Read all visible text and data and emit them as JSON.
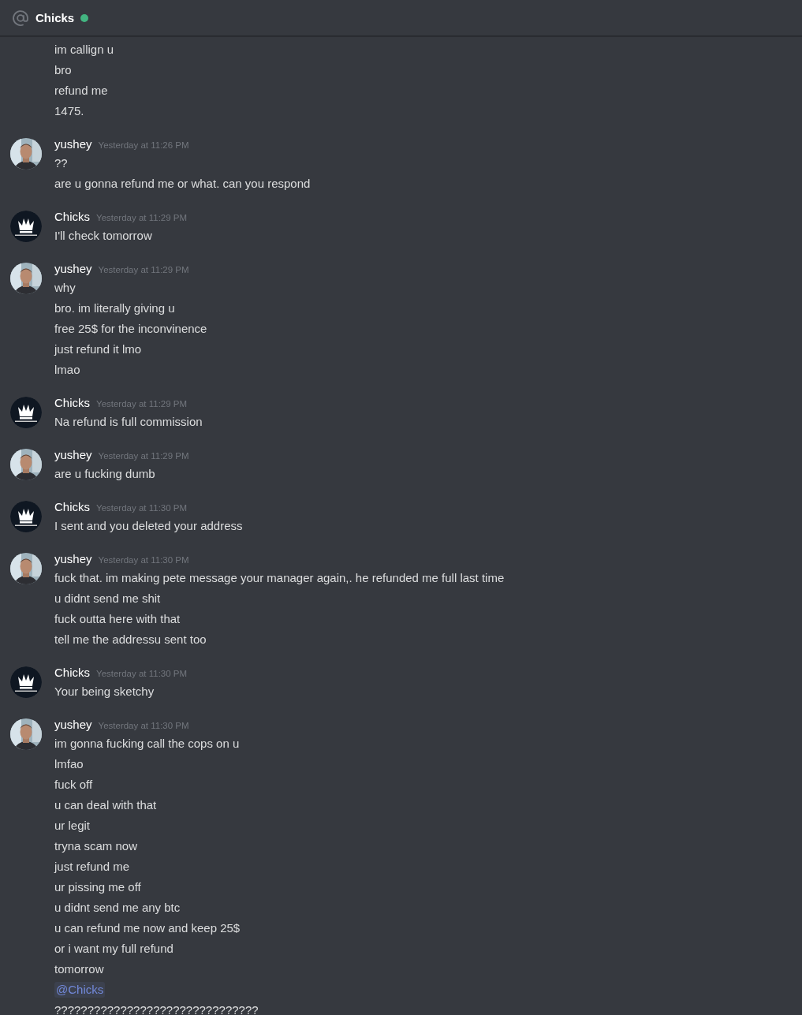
{
  "header": {
    "title": "Chicks",
    "online": true
  },
  "messages": [
    {
      "lines": [
        {
          "kind": "text",
          "text": "im callign u"
        },
        {
          "kind": "text",
          "text": "bro"
        },
        {
          "kind": "text",
          "text": "refund me"
        },
        {
          "kind": "text",
          "text": "1475."
        }
      ]
    },
    {
      "author": "yushey",
      "avatar": {
        "kind": "picture"
      },
      "timestamp": "Yesterday at 11:26 PM",
      "lines": [
        {
          "kind": "text",
          "text": "??"
        },
        {
          "kind": "text",
          "text": "are u gonna refund me or what. can you respond"
        }
      ]
    },
    {
      "author": "Chicks",
      "avatar": {
        "kind": "logo"
      },
      "timestamp": "Yesterday at 11:29 PM",
      "lines": [
        {
          "kind": "text",
          "text": "I'll check tomorrow"
        }
      ]
    },
    {
      "author": "yushey",
      "avatar": {
        "kind": "picture"
      },
      "timestamp": "Yesterday at 11:29 PM",
      "lines": [
        {
          "kind": "text",
          "text": "why"
        },
        {
          "kind": "text",
          "text": "bro. im literally giving u"
        },
        {
          "kind": "text",
          "text": "free 25$ for the inconvinence"
        },
        {
          "kind": "text",
          "text": "just refund it lmo"
        },
        {
          "kind": "text",
          "text": "lmao"
        }
      ]
    },
    {
      "author": "Chicks",
      "avatar": {
        "kind": "logo"
      },
      "timestamp": "Yesterday at 11:29 PM",
      "lines": [
        {
          "kind": "text",
          "text": "Na refund is full commission"
        }
      ]
    },
    {
      "author": "yushey",
      "avatar": {
        "kind": "picture"
      },
      "timestamp": "Yesterday at 11:29 PM",
      "lines": [
        {
          "kind": "text",
          "text": "are u fucking dumb"
        }
      ]
    },
    {
      "author": "Chicks",
      "avatar": {
        "kind": "logo"
      },
      "timestamp": "Yesterday at 11:30 PM",
      "lines": [
        {
          "kind": "text",
          "text": "I sent and you deleted your address"
        }
      ]
    },
    {
      "author": "yushey",
      "avatar": {
        "kind": "picture"
      },
      "timestamp": "Yesterday at 11:30 PM",
      "lines": [
        {
          "kind": "text",
          "text": "fuck that. im making pete message your manager again,. he refunded me full last time"
        },
        {
          "kind": "text",
          "text": "u didnt send me shit"
        },
        {
          "kind": "text",
          "text": "fuck outta here with that"
        },
        {
          "kind": "text",
          "text": "tell me the addressu  sent too"
        }
      ]
    },
    {
      "author": "Chicks",
      "avatar": {
        "kind": "logo"
      },
      "timestamp": "Yesterday at 11:30 PM",
      "lines": [
        {
          "kind": "text",
          "text": "Your being sketchy"
        }
      ]
    },
    {
      "author": "yushey",
      "avatar": {
        "kind": "picture"
      },
      "timestamp": "Yesterday at 11:30 PM",
      "lines": [
        {
          "kind": "text",
          "text": "im gonna fucking call the cops on u"
        },
        {
          "kind": "text",
          "text": "lmfao"
        },
        {
          "kind": "text",
          "text": "fuck off"
        },
        {
          "kind": "text",
          "text": "u can deal with that"
        },
        {
          "kind": "text",
          "text": "ur legit"
        },
        {
          "kind": "text",
          "text": "tryna scam now"
        },
        {
          "kind": "text",
          "text": "just refund me"
        },
        {
          "kind": "text",
          "text": "ur pissing me off"
        },
        {
          "kind": "text",
          "text": "u didnt send me any btc"
        },
        {
          "kind": "text",
          "text": "u can refund me now and keep 25$"
        },
        {
          "kind": "text",
          "text": "or i want my full refund"
        },
        {
          "kind": "text",
          "text": "tomorrow"
        },
        {
          "kind": "mention",
          "text": "@Chicks"
        },
        {
          "kind": "text",
          "text": "???????????????????????????????"
        }
      ]
    }
  ]
}
